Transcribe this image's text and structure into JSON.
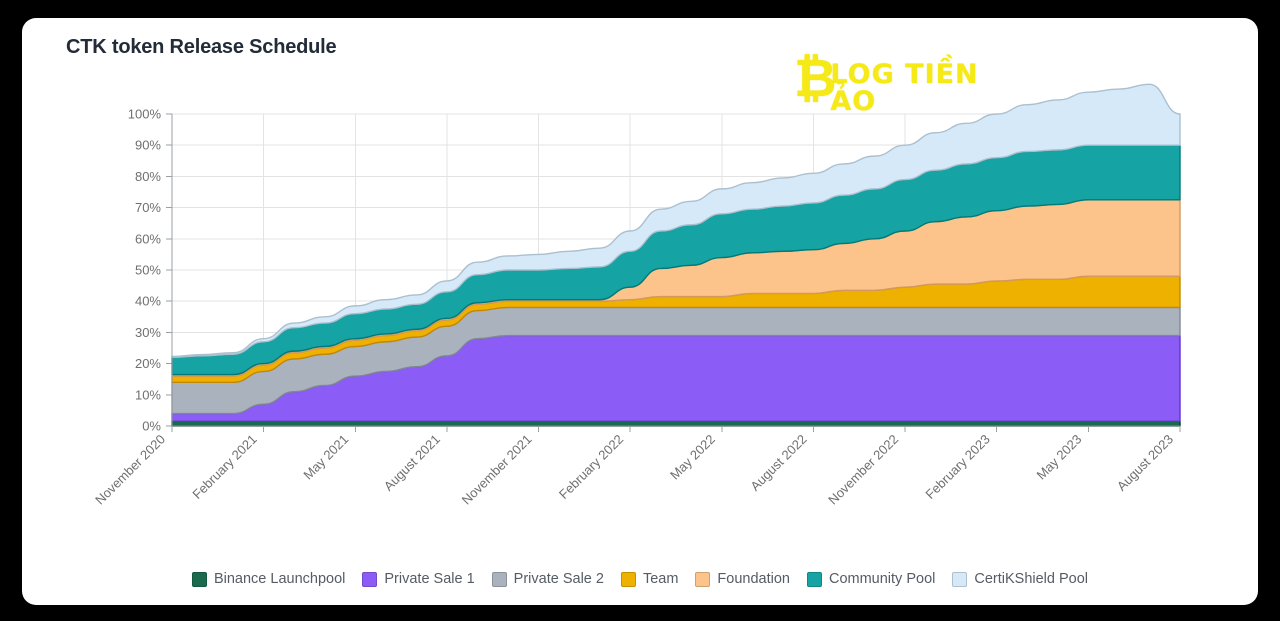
{
  "window": {
    "background_color": "#000000",
    "card_color": "#ffffff"
  },
  "header": {
    "title": "CTK token Release Schedule"
  },
  "watermark": {
    "symbol": "₿",
    "text": "LOG TIỀN ẢO",
    "color": "#f5e90b",
    "name": "blog-tien-ao-watermark"
  },
  "chart_data": {
    "type": "area",
    "stacked": true,
    "title": "CTK token Release Schedule",
    "xlabel": "",
    "ylabel": "",
    "ylim": [
      0,
      100
    ],
    "y_tick_suffix": "%",
    "grid": true,
    "legend_position": "bottom",
    "y_ticks": [
      "0%",
      "10%",
      "20%",
      "30%",
      "40%",
      "50%",
      "60%",
      "70%",
      "80%",
      "90%",
      "100%"
    ],
    "y_tick_values": [
      0,
      10,
      20,
      30,
      40,
      50,
      60,
      70,
      80,
      90,
      100
    ],
    "x_tick_labels": [
      "November 2020",
      "February 2021",
      "May 2021",
      "August 2021",
      "November 2021",
      "February 2022",
      "May 2022",
      "August 2022",
      "November 2022",
      "February 2023",
      "May 2023",
      "August 2023"
    ],
    "x": [
      "November 2020",
      "December 2020",
      "January 2021",
      "February 2021",
      "March 2021",
      "April 2021",
      "May 2021",
      "June 2021",
      "July 2021",
      "August 2021",
      "September 2021",
      "October 2021",
      "November 2021",
      "December 2021",
      "January 2022",
      "February 2022",
      "March 2022",
      "April 2022",
      "May 2022",
      "June 2022",
      "July 2022",
      "August 2022",
      "September 2022",
      "October 2022",
      "November 2022",
      "December 2022",
      "January 2023",
      "February 2023",
      "March 2023",
      "April 2023",
      "May 2023",
      "June 2023",
      "July 2023",
      "August 2023"
    ],
    "series": [
      {
        "name": "Binance Launchpool",
        "color": "#1a6b4e",
        "values": [
          1.5,
          1.5,
          1.5,
          1.5,
          1.5,
          1.5,
          1.5,
          1.5,
          1.5,
          1.5,
          1.5,
          1.5,
          1.5,
          1.5,
          1.5,
          1.5,
          1.5,
          1.5,
          1.5,
          1.5,
          1.5,
          1.5,
          1.5,
          1.5,
          1.5,
          1.5,
          1.5,
          1.5,
          1.5,
          1.5,
          1.5,
          1.5,
          1.5,
          1.5
        ]
      },
      {
        "name": "Private Sale 1",
        "color": "#8b5cf6",
        "values": [
          2.5,
          2.5,
          2.5,
          5.5,
          9.5,
          11.5,
          14.5,
          16.0,
          17.5,
          21.0,
          26.5,
          27.5,
          27.5,
          27.5,
          27.5,
          27.5,
          27.5,
          27.5,
          27.5,
          27.5,
          27.5,
          27.5,
          27.5,
          27.5,
          27.5,
          27.5,
          27.5,
          27.5,
          27.5,
          27.5,
          27.5,
          27.5,
          27.5,
          27.5
        ]
      },
      {
        "name": "Private Sale 2",
        "color": "#aab2bd",
        "values": [
          10.0,
          10.0,
          10.0,
          10.5,
          10.5,
          10.0,
          9.5,
          9.5,
          9.5,
          9.5,
          9.0,
          9.0,
          9.0,
          9.0,
          9.0,
          9.0,
          9.0,
          9.0,
          9.0,
          9.0,
          9.0,
          9.0,
          9.0,
          9.0,
          9.0,
          9.0,
          9.0,
          9.0,
          9.0,
          9.0,
          9.0,
          9.0,
          9.0,
          9.0
        ]
      },
      {
        "name": "Team",
        "color": "#efb100",
        "values": [
          2.0,
          2.0,
          2.0,
          2.0,
          2.0,
          2.0,
          2.0,
          2.0,
          2.0,
          2.0,
          2.0,
          2.0,
          2.0,
          2.0,
          2.0,
          2.5,
          3.5,
          3.5,
          3.5,
          4.5,
          4.5,
          4.5,
          5.5,
          5.5,
          6.5,
          7.5,
          7.5,
          8.5,
          9.0,
          9.0,
          10.0,
          10.0,
          10.0,
          10.0
        ]
      },
      {
        "name": "Foundation",
        "color": "#fcc38a",
        "values": [
          0.5,
          0.5,
          0.5,
          0.5,
          0.5,
          0.5,
          0.5,
          0.5,
          0.5,
          0.5,
          0.5,
          0.5,
          0.5,
          0.5,
          0.5,
          4.0,
          9.0,
          10.0,
          12.5,
          13.0,
          13.5,
          14.0,
          15.0,
          16.5,
          18.0,
          20.0,
          21.5,
          22.5,
          23.5,
          24.0,
          24.5,
          24.5,
          24.5,
          24.5
        ]
      },
      {
        "name": "Community Pool",
        "color": "#16a3a3",
        "values": [
          5.5,
          6.0,
          6.5,
          7.0,
          7.5,
          7.5,
          8.0,
          8.0,
          8.0,
          8.5,
          9.0,
          9.5,
          9.5,
          10.0,
          10.5,
          11.5,
          12.0,
          13.0,
          14.0,
          14.0,
          14.5,
          15.0,
          15.5,
          16.0,
          16.5,
          16.5,
          17.0,
          17.0,
          17.5,
          17.5,
          17.5,
          17.5,
          17.5,
          17.5
        ]
      },
      {
        "name": "CertiKShield Pool",
        "color": "#d6e9f8",
        "values": [
          0.3,
          0.4,
          0.5,
          1.0,
          1.5,
          2.0,
          2.5,
          3.0,
          3.0,
          3.5,
          4.0,
          4.5,
          5.0,
          5.5,
          6.0,
          6.5,
          7.0,
          7.5,
          8.0,
          8.5,
          9.0,
          9.5,
          10.0,
          10.5,
          11.0,
          12.0,
          13.0,
          14.0,
          15.0,
          16.0,
          17.0,
          18.0,
          19.5,
          10.0
        ]
      }
    ],
    "endpoint_totals": {
      "Binance Launchpool": 1.5,
      "Private Sale 1": 29.0,
      "Private Sale 2": 38.5,
      "Team": 49.5,
      "Foundation": 74.0,
      "Community Pool": 91.5,
      "CertiKShield Pool": 100.0
    }
  },
  "legend": {
    "items": [
      {
        "label": "Binance Launchpool",
        "color": "#1a6b4e"
      },
      {
        "label": "Private Sale 1",
        "color": "#8b5cf6"
      },
      {
        "label": "Private Sale 2",
        "color": "#aab2bd"
      },
      {
        "label": "Team",
        "color": "#efb100"
      },
      {
        "label": "Foundation",
        "color": "#fcc38a"
      },
      {
        "label": "Community Pool",
        "color": "#16a3a3"
      },
      {
        "label": "CertiKShield Pool",
        "color": "#d6e9f8"
      }
    ]
  }
}
